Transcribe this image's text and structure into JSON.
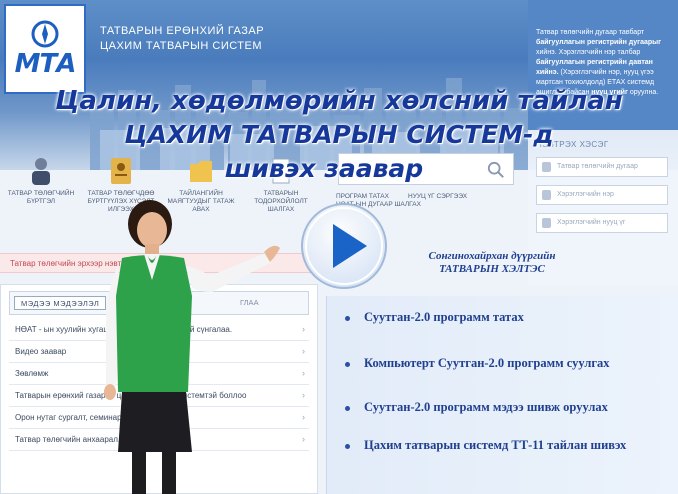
{
  "header": {
    "logo_text": "МТА",
    "system_title_line1": "ТАТВАРЫН ЕРӨНХИЙ ГАЗАР",
    "system_title_line2": "ЦАХИМ ТАТВАРЫН СИСТЕМ"
  },
  "video_title": {
    "line1": "Цалин, хөдөлмөрийн хөлсний тайлан",
    "line2": "ЦАХИМ ТАТВАРЫН СИСТЕМ-д",
    "line3": "шивэх заавар"
  },
  "search": {
    "placeholder": ""
  },
  "nav": {
    "items": [
      {
        "label": "ТАТВАР ТӨЛӨГЧИЙН БҮРТГЭЛ"
      },
      {
        "label": "ТАТВАР ТӨЛӨГЧДӨӨ БҮРТГҮҮЛЭХ ХҮСЭЛТ ИЛГЭЭХ"
      },
      {
        "label": "ТАЙЛАНГИЙН МАЯГТУУДЫГ ТАТАЖ АВАХ"
      },
      {
        "label": "ТАТВАРЫН ТОДОРХОЙЛОЛТ ШАЛГАХ"
      }
    ],
    "extra": [
      {
        "label": "ПРОГРАМ ТАТАХ"
      },
      {
        "label": "НӨАТ-ЫН ДУГААР ШАЛГАХ"
      },
      {
        "label": "НУУЦ ҮГ СЭРГЭЭХ"
      }
    ]
  },
  "alert": {
    "text": "Татвар төлөгчийн эрхээр нэвтрэх"
  },
  "info_panel": {
    "text1": "Татвар төлөгчийн дугаар тавбарт",
    "bold1": "байгууллагын регистрийн дугаарыг",
    "text2": "хийнэ.",
    "text3": "Хэрэглэгчийн нэр талбар",
    "bold2": "байгууллагын регистрийн",
    "bold3": "давтан хийнэ.",
    "text4": "(Хэрэглэгчийн нэр, нууц үгээ мартсан тохиолдолд)",
    "text5": "ЕТАХ системд ашиглаж байсан",
    "bold4": "нууц үгийг",
    "text6": "оруулна."
  },
  "login": {
    "title": "НЭВТРЭХ ХЭСЭГ",
    "fields": [
      {
        "placeholder": "Татвар төлөгчийн дугаар"
      },
      {
        "placeholder": "Хэрэглэгчийн нэр"
      },
      {
        "placeholder": "Хэрэглэгчийн нууц үг"
      }
    ]
  },
  "list_panel": {
    "tab_active": "МЭДЭЭ МЭДЭЭЛЭЛ",
    "tab_other": "ГЛАА",
    "items": [
      {
        "label": "НӨАТ - ын хуулийн хугацаанд тайлан ... дүүстай сүнгалаа."
      },
      {
        "label": "Видео заавар"
      },
      {
        "label": "Зөвлөмж"
      },
      {
        "label": "Татварын ерөнхий газар ... цахим татварын системтэй боллоо"
      },
      {
        "label": "Орон нутаг сургалт, семинар"
      },
      {
        "label": "Татвар төлөгчийн анхаарал..."
      }
    ]
  },
  "author": {
    "line1": "Сонгинохайрхан дүүргийн",
    "line2": "ТАТВАРЫН ХЭЛТЭС"
  },
  "bullets": [
    "Суутган-2.0 программ татах",
    "Компьютерт Суутган-2.0 программ суулгах",
    "Суутган-2.0 программ мэдээ шивж оруулах",
    "Цахим татварын системд ТТ-11 тайлан шивэх"
  ],
  "colors": {
    "title_blue": "#16389a",
    "bullet_blue": "#1f3f8f",
    "header_blue": "#4a7cbd",
    "play_blue": "#1a63c7"
  }
}
